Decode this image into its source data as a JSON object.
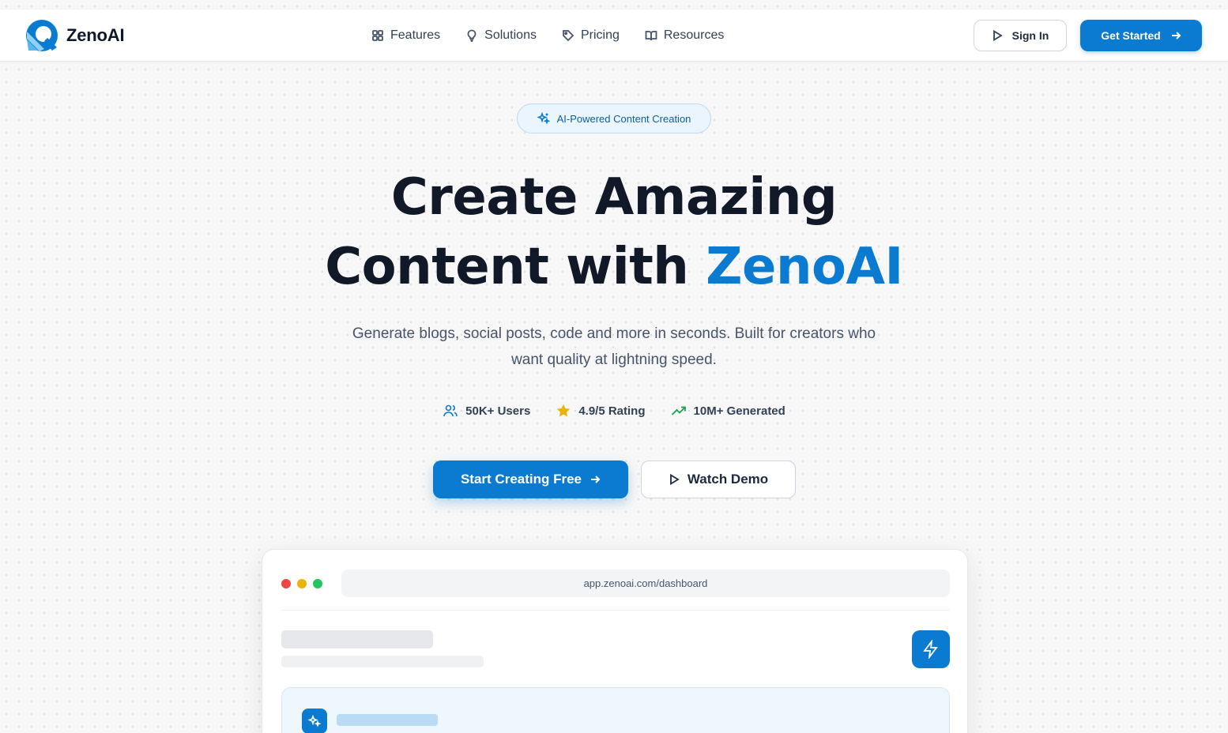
{
  "brand": {
    "name": "ZenoAI",
    "accent_color": "#0a7bd0"
  },
  "nav": {
    "items": [
      {
        "label": "Features",
        "icon": "grid-icon"
      },
      {
        "label": "Solutions",
        "icon": "lightbulb-icon"
      },
      {
        "label": "Pricing",
        "icon": "tag-icon"
      },
      {
        "label": "Resources",
        "icon": "book-icon"
      }
    ],
    "sign_in_label": "Sign In",
    "get_started_label": "Get Started"
  },
  "hero": {
    "badge": "AI-Powered Content Creation",
    "headline_line1": "Create Amazing",
    "headline_line2_prefix": "Content with ",
    "headline_line2_accent": "ZenoAI",
    "subtitle": "Generate blogs, social posts, code and more in seconds. Built for creators who want quality at lightning speed.",
    "stats": [
      {
        "label": "50K+ Users",
        "icon": "users-icon"
      },
      {
        "label": "4.9/5 Rating",
        "icon": "star-icon"
      },
      {
        "label": "10M+ Generated",
        "icon": "trending-up-icon"
      }
    ],
    "primary_cta": "Start Creating Free",
    "secondary_cta": "Watch Demo"
  },
  "preview": {
    "url": "app.zenoai.com/dashboard",
    "window_dot_colors": [
      "#ef4444",
      "#eab308",
      "#22c55e"
    ]
  }
}
